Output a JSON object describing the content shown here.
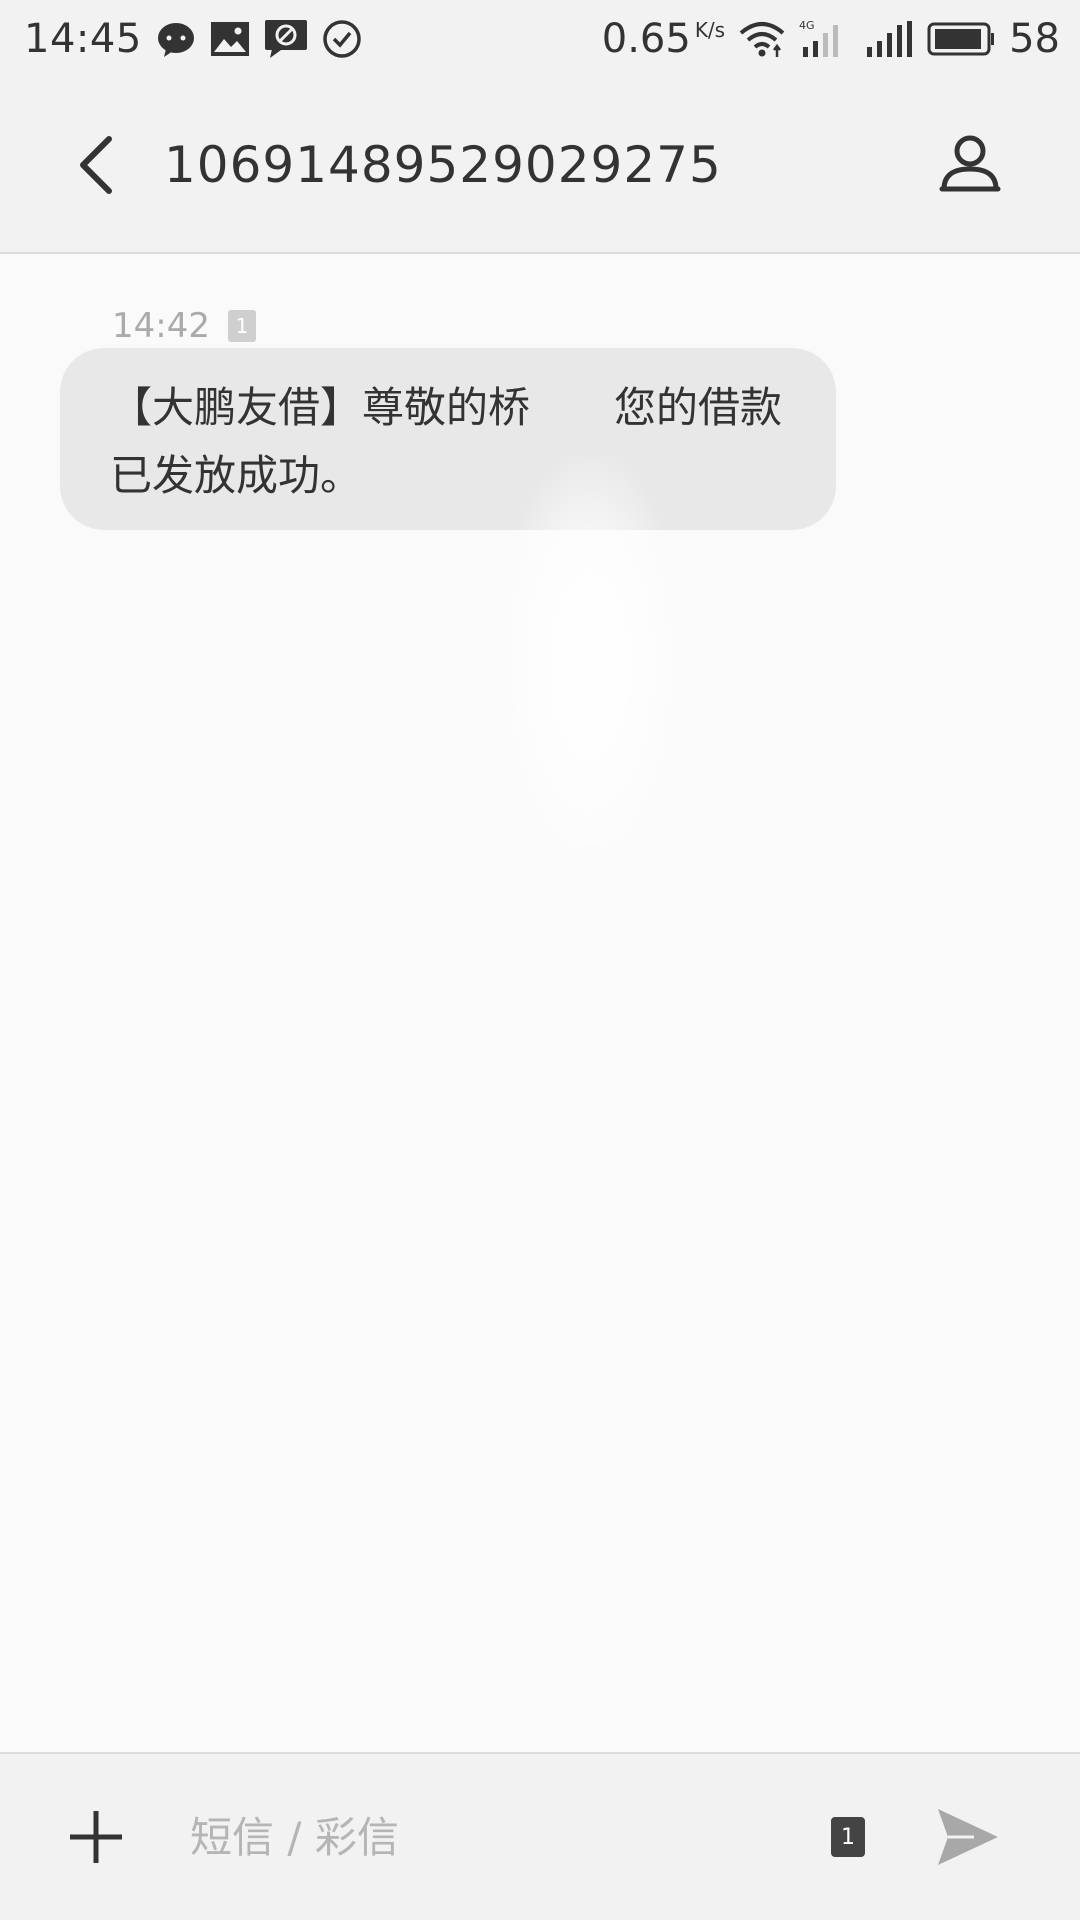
{
  "status_bar": {
    "time": "14:45",
    "icons_left": [
      "chat-bubble-icon",
      "image-icon",
      "blocked-message-icon",
      "check-circle-icon"
    ],
    "net_speed": "0.65",
    "net_speed_unit": "K/s",
    "network_type": "4G",
    "battery_percent": "58"
  },
  "header": {
    "back_icon": "chevron-left-icon",
    "title": "10691489529029275",
    "contact_icon": "person-icon"
  },
  "messages": [
    {
      "time": "14:42",
      "sim": "1",
      "text": "【大鹏友借】尊敬的桥　　您的借款已发放成功。"
    }
  ],
  "composer": {
    "add_icon": "plus-icon",
    "placeholder": "短信 / 彩信",
    "value": "",
    "sim": "1",
    "send_icon": "send-icon"
  },
  "colors": {
    "background": "#fafafa",
    "bar": "#f2f2f2",
    "bubble": "#e8e8e8",
    "text": "#333333",
    "muted": "#aaaaaa"
  }
}
